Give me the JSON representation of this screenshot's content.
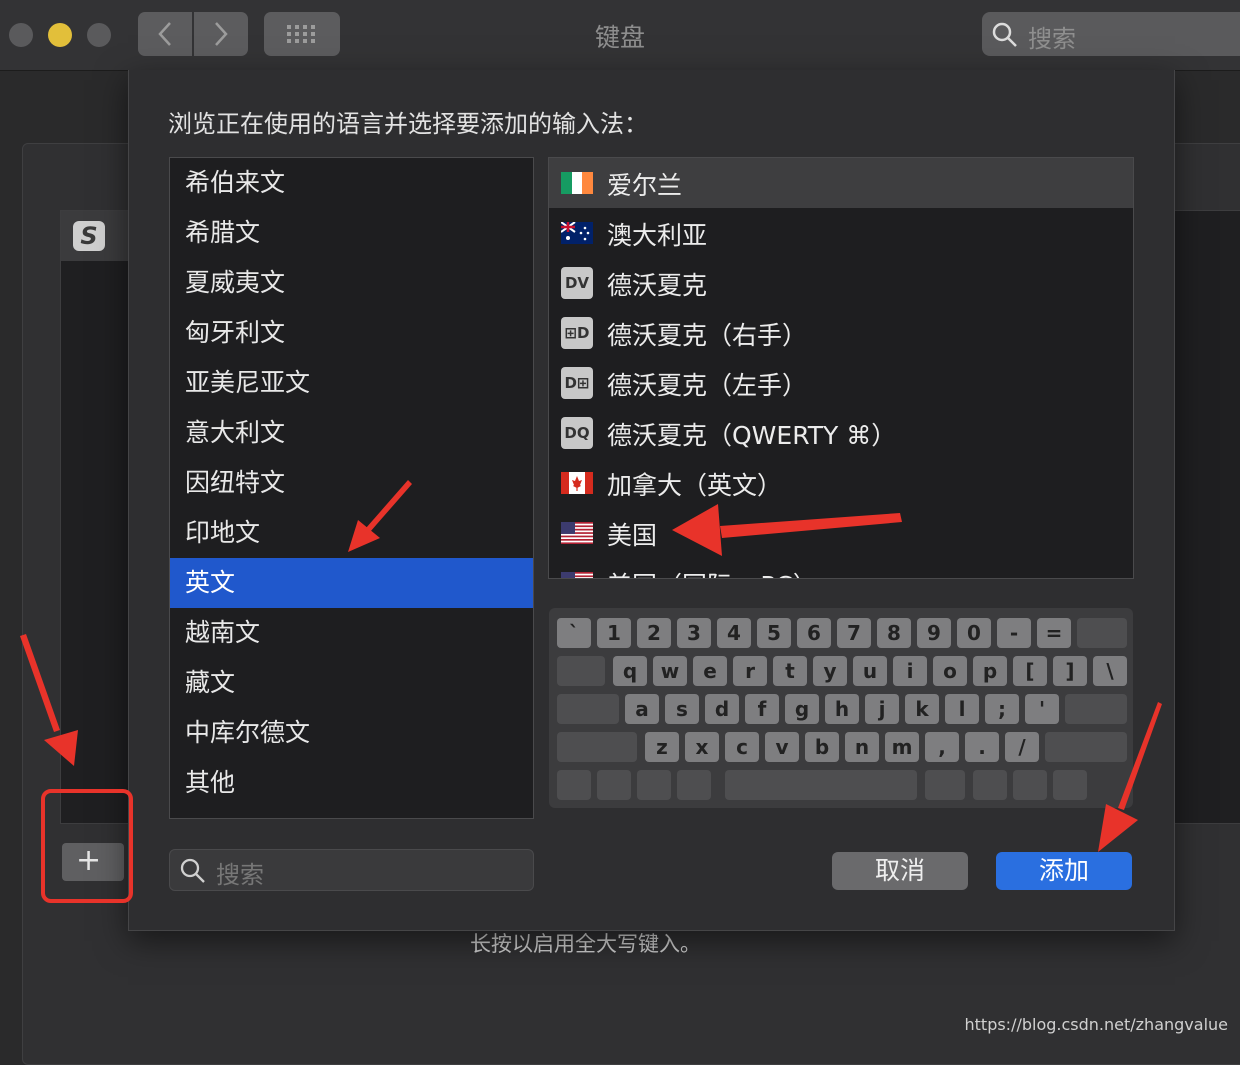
{
  "window": {
    "title": "键盘"
  },
  "toolbar": {
    "search_placeholder": "搜索"
  },
  "background": {
    "hint": "长按以启用全大写键入。",
    "add_label": "+"
  },
  "sheet": {
    "prompt": "浏览正在使用的语言并选择要添加的输入法：",
    "languages": [
      {
        "label": "希伯来文"
      },
      {
        "label": "希腊文"
      },
      {
        "label": "夏威夷文"
      },
      {
        "label": "匈牙利文"
      },
      {
        "label": "亚美尼亚文"
      },
      {
        "label": "意大利文"
      },
      {
        "label": "因纽特文"
      },
      {
        "label": "印地文"
      },
      {
        "label": "英文"
      },
      {
        "label": "越南文"
      },
      {
        "label": "藏文"
      },
      {
        "label": "中库尔德文"
      },
      {
        "label": "其他"
      }
    ],
    "selected_language": "英文",
    "sources": [
      {
        "label": "爱尔兰",
        "icon": "flag-ireland-icon"
      },
      {
        "label": "澳大利亚",
        "icon": "flag-australia-icon"
      },
      {
        "label": "德沃夏克",
        "icon": "dvorak-icon",
        "badge": "DV"
      },
      {
        "label": "德沃夏克（右手）",
        "icon": "dvorak-right-icon",
        "badge": "⊞D"
      },
      {
        "label": "德沃夏克（左手）",
        "icon": "dvorak-left-icon",
        "badge": "D⊞"
      },
      {
        "label": "德沃夏克（QWERTY ⌘）",
        "icon": "dvorak-qwerty-icon",
        "badge": "DQ"
      },
      {
        "label": "加拿大（英文）",
        "icon": "flag-canada-icon"
      },
      {
        "label": "美国",
        "icon": "flag-usa-icon"
      },
      {
        "label": "美国（国际 – PC）",
        "icon": "flag-usa-icon"
      }
    ],
    "search_placeholder": "搜索",
    "cancel_label": "取消",
    "add_label": "添加"
  },
  "keyboard": {
    "row1": [
      "`",
      "1",
      "2",
      "3",
      "4",
      "5",
      "6",
      "7",
      "8",
      "9",
      "0",
      "-",
      "="
    ],
    "row2": [
      "q",
      "w",
      "e",
      "r",
      "t",
      "y",
      "u",
      "i",
      "o",
      "p",
      "[",
      "]",
      "\\"
    ],
    "row3": [
      "a",
      "s",
      "d",
      "f",
      "g",
      "h",
      "j",
      "k",
      "l",
      ";",
      "'"
    ],
    "row4": [
      "z",
      "x",
      "c",
      "v",
      "b",
      "n",
      "m",
      ",",
      ".",
      "/"
    ]
  },
  "watermark": "https://blog.csdn.net/zhangvalue",
  "colors": {
    "selection": "#2058cc",
    "primary_button": "#2a6fe0",
    "annotation": "#e8332a"
  }
}
